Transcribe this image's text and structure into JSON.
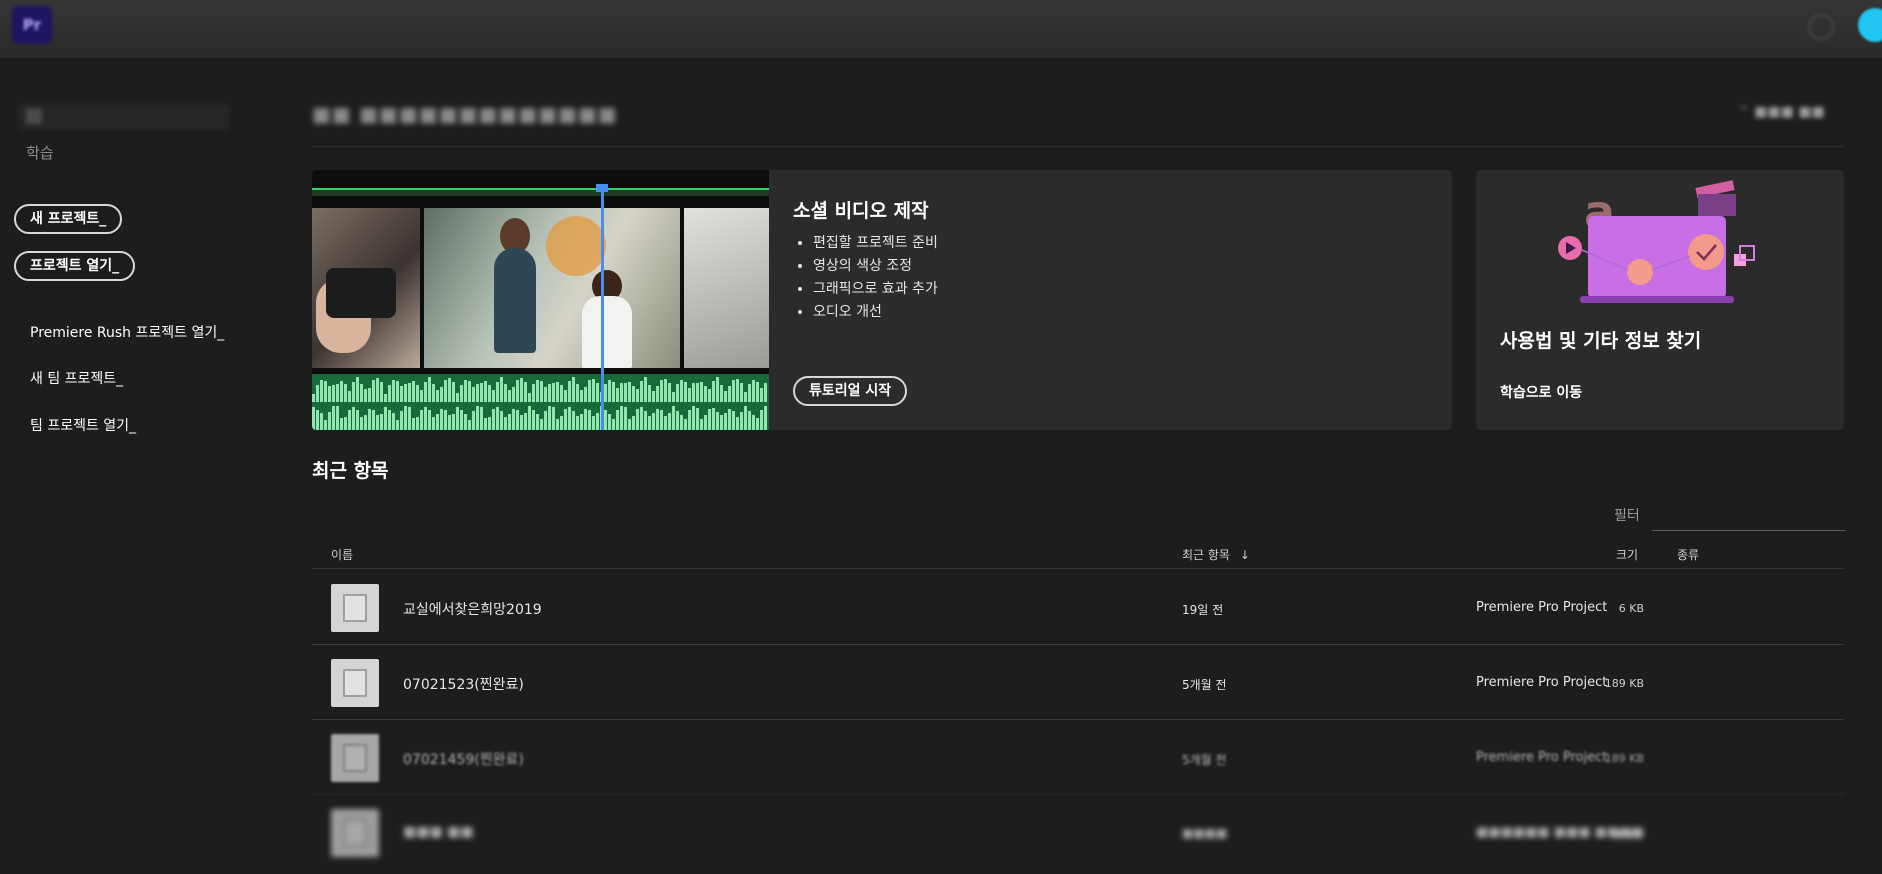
{
  "app": {
    "logo_text": "Pr"
  },
  "sidebar": {
    "learn_label": "학습",
    "new_project": "새 프로젝트_",
    "open_project": "프로젝트 열기_",
    "links": [
      "Premiere Rush 프로젝트 열기_",
      "새 팀 프로젝트_",
      "팀 프로젝트 열기_"
    ]
  },
  "main": {
    "feature": {
      "title": "소셜 비디오 제작",
      "bullets": [
        "편집할 프로젝트 준비",
        "영상의 색상 조정",
        "그래픽으로 효과 추가",
        "오디오 개선"
      ],
      "cta": "튜토리얼 시작"
    },
    "learn_card": {
      "title": "사용법 및 기타 정보 찾기",
      "cta": "학습으로 이동"
    }
  },
  "recent": {
    "title": "최근 항목",
    "filter_label": "필터",
    "filter_value": "",
    "columns": {
      "name": "이름",
      "recent": "최근 항목",
      "size": "크기",
      "kind": "종류"
    },
    "rows": [
      {
        "name": "교실에서찾은희망2019",
        "date": "19일 전",
        "size": "6 KB",
        "kind": "Premiere Pro Project"
      },
      {
        "name": "07021523(찐완료)",
        "date": "5개월 전",
        "size": "189 KB",
        "kind": "Premiere Pro Project"
      },
      {
        "name": "07021459(찐완료)",
        "date": "5개월 전",
        "size": "189 KB",
        "kind": "Premiere Pro Project"
      }
    ]
  },
  "colors": {
    "accent_playhead": "#4a8cf6",
    "audio_green": "#166b3b",
    "avatar": "#20c6f0"
  }
}
